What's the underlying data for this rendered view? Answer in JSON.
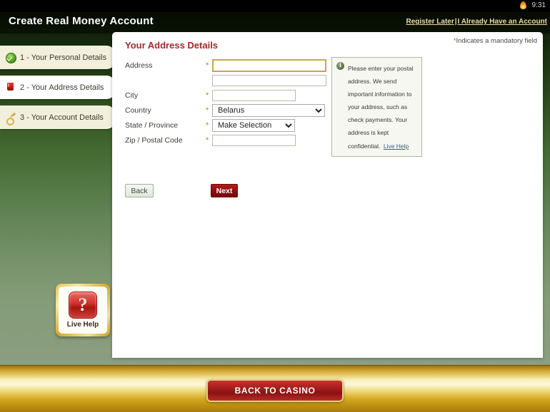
{
  "statusbar": {
    "time": "9:31",
    "icon": "flame-icon"
  },
  "header": {
    "title": "Create Real Money Account",
    "register_later": "Register Later",
    "separator": "|",
    "already_have_account": "I Already Have an Account"
  },
  "sidebar": {
    "items": [
      {
        "label": "1 - Your Personal Details",
        "icon": "check-circle-icon",
        "state": "completed"
      },
      {
        "label": "2 - Your Address Details",
        "icon": "red-marker-icon",
        "state": "active"
      },
      {
        "label": "3 - Your Account Details",
        "icon": "gold-key-icon",
        "state": "pending"
      }
    ]
  },
  "panel": {
    "title": "Your Address Details",
    "mandatory_star": "*",
    "mandatory_note": "Indicates a mandatory field"
  },
  "form": {
    "fields": [
      {
        "label": "Address",
        "required": true,
        "type": "text",
        "value": "",
        "placeholder": ""
      },
      {
        "label": "",
        "required": false,
        "type": "text",
        "value": "",
        "placeholder": ""
      },
      {
        "label": "City",
        "required": true,
        "type": "text",
        "value": "",
        "placeholder": ""
      },
      {
        "label": "Country",
        "required": true,
        "type": "select",
        "value": "Belarus"
      },
      {
        "label": "State / Province",
        "required": true,
        "type": "select",
        "value": "Make Selection"
      },
      {
        "label": "Zip / Postal Code",
        "required": true,
        "type": "text",
        "value": "",
        "placeholder": ""
      }
    ],
    "country_options": [
      "Belarus"
    ],
    "state_options": [
      "Make Selection"
    ],
    "back_button": "Back",
    "next_button": "Next"
  },
  "infobox": {
    "icon": "info-circle-icon",
    "text": "Please enter your postal address. We send important information to your address, such as check payments. Your address is kept confidential.",
    "link": "Live Help"
  },
  "livehelp": {
    "icon": "question-mark-icon",
    "label": "Live Help"
  },
  "footer": {
    "back_to_casino": "BACK TO CASINO"
  },
  "colors": {
    "accent_red": "#9e2a2b",
    "gold": "#d4a82c",
    "panel_bg": "#ffffff",
    "backdrop_green": "#45683a",
    "required_star": "#cc7722"
  }
}
